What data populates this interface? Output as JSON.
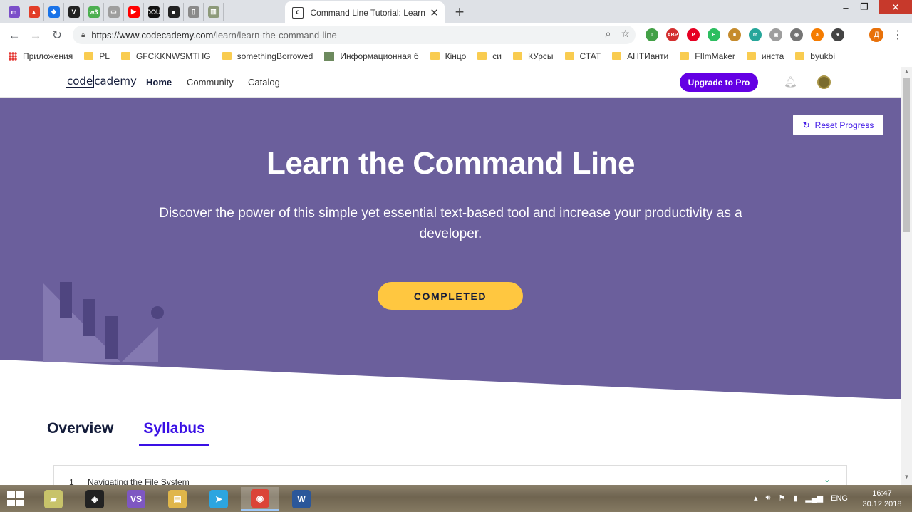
{
  "browser": {
    "pinned_tabs": [
      {
        "icon": "m-icon",
        "glyph": "m",
        "color": "#7b4fc9"
      },
      {
        "icon": "photo-icon",
        "glyph": "▲",
        "color": "#e23d28"
      },
      {
        "icon": "blue-app-icon",
        "glyph": "◆",
        "color": "#1a73e8"
      },
      {
        "icon": "v-icon",
        "glyph": "V",
        "color": "#222222"
      },
      {
        "icon": "w3-icon",
        "glyph": "w3",
        "color": "#4caf50"
      },
      {
        "icon": "calendar-icon",
        "glyph": "▭",
        "color": "#9e9e9e"
      },
      {
        "icon": "youtube-icon",
        "glyph": "▶",
        "color": "#ff0000"
      },
      {
        "icon": "dou-icon",
        "glyph": "DOU",
        "color": "#111111"
      },
      {
        "icon": "github-icon",
        "glyph": "●",
        "color": "#222222"
      },
      {
        "icon": "document-icon",
        "glyph": "▯",
        "color": "#8a8a8a"
      },
      {
        "icon": "book-icon",
        "glyph": "▥",
        "color": "#8d9a7a"
      }
    ],
    "active_tab": {
      "title": "Command Line Tutorial: Learn The",
      "favicon": "c"
    },
    "new_tab_glyph": "+",
    "window_controls": {
      "minimize": "‒",
      "restore": "❐",
      "close": "✕"
    },
    "url": {
      "host": "https://www.codecademy.com",
      "path": "/learn/learn-the-command-line"
    },
    "extensions": [
      {
        "icon": "green-ext-icon",
        "glyph": "0",
        "color": "#43a047"
      },
      {
        "icon": "adblock-icon",
        "glyph": "ABP",
        "color": "#d32f2f"
      },
      {
        "icon": "pinterest-icon",
        "glyph": "P",
        "color": "#e60023"
      },
      {
        "icon": "evernote-icon",
        "glyph": "E",
        "color": "#2dbe60"
      },
      {
        "icon": "ext-box-icon",
        "glyph": "■",
        "color": "#c58b2c"
      },
      {
        "icon": "m-ext-icon",
        "glyph": "m",
        "color": "#26a69a"
      },
      {
        "icon": "ext-gray-icon",
        "glyph": "▣",
        "color": "#9e9e9e"
      },
      {
        "icon": "camera-icon",
        "glyph": "◉",
        "color": "#757575"
      },
      {
        "icon": "shop-icon",
        "glyph": "a",
        "color": "#f57c00"
      },
      {
        "icon": "pocket-icon",
        "glyph": "♥",
        "color": "#444444"
      }
    ],
    "profile_letter": "Д"
  },
  "bookmarks": [
    {
      "label": "Приложения",
      "kind": "apps"
    },
    {
      "label": "PL",
      "kind": "folder"
    },
    {
      "label": "GFCKKNWSMTHG",
      "kind": "folder"
    },
    {
      "label": "somethingBorrowed",
      "kind": "folder"
    },
    {
      "label": "Информационная б",
      "kind": "pic"
    },
    {
      "label": "Кінцо",
      "kind": "folder"
    },
    {
      "label": "си",
      "kind": "folder"
    },
    {
      "label": "КУрсы",
      "kind": "folder"
    },
    {
      "label": "СТАТ",
      "kind": "folder"
    },
    {
      "label": "АНТИанти",
      "kind": "folder"
    },
    {
      "label": "FIlmMaker",
      "kind": "folder"
    },
    {
      "label": "инста",
      "kind": "folder"
    },
    {
      "label": "byukbi",
      "kind": "folder"
    }
  ],
  "site": {
    "logo_box": "code",
    "logo_rest": "cademy",
    "nav": {
      "home": "Home",
      "community": "Community",
      "catalog": "Catalog"
    },
    "upgrade": "Upgrade to Pro",
    "colors": {
      "hero": "#6b5f9c",
      "accent": "#3a10e5",
      "pro": "#6400e4",
      "completed": "#ffc740"
    }
  },
  "hero": {
    "reset": "Reset Progress",
    "title": "Learn the Command Line",
    "description": "Discover the power of this simple yet essential text-based tool and increase your productivity as a developer.",
    "status_button": "COMPLETED"
  },
  "tabs": {
    "overview": "Overview",
    "syllabus": "Syllabus"
  },
  "syllabus": [
    {
      "number": "1",
      "name": "Navigating the File System"
    }
  ],
  "taskbar": {
    "apps": [
      {
        "icon": "explorer-folder-icon",
        "glyph": "▰",
        "color": "#c8c36a"
      },
      {
        "icon": "unity-icon",
        "glyph": "◈",
        "color": "#222222"
      },
      {
        "icon": "visual-studio-icon",
        "glyph": "VS",
        "color": "#7e57c2"
      },
      {
        "icon": "file-explorer-icon",
        "glyph": "▤",
        "color": "#e0b64a"
      },
      {
        "icon": "telegram-icon",
        "glyph": "➤",
        "color": "#2ca5e0"
      },
      {
        "icon": "chrome-icon",
        "glyph": "◉",
        "color": "#db4437"
      },
      {
        "icon": "word-icon",
        "glyph": "W",
        "color": "#2b579a"
      }
    ],
    "active_app": 5,
    "language": "ENG",
    "time": "16:47",
    "date": "30.12.2018"
  }
}
